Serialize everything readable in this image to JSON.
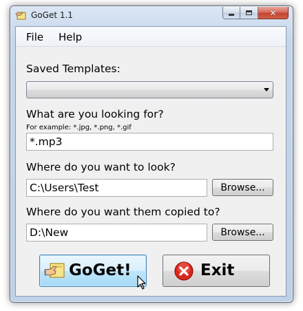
{
  "window": {
    "title": "GoGet 1.1",
    "close_glyph": "✕"
  },
  "menu": {
    "file": "File",
    "help": "Help"
  },
  "templates": {
    "label": "Saved Templates:",
    "selected": ""
  },
  "looking_for": {
    "label": "What are you looking for?",
    "hint": "For example: *.jpg, *.png, *.gif",
    "value": "*.mp3"
  },
  "look_in": {
    "label": "Where do you want to look?",
    "value": "C:\\Users\\Test",
    "browse_label": "Browse..."
  },
  "copy_to": {
    "label": "Where do you want them copied to?",
    "value": "D:\\New",
    "browse_label": "Browse..."
  },
  "actions": {
    "goget_label": "GoGet!",
    "exit_label": "Exit"
  },
  "icons": {
    "app": "app-hand-icon",
    "goget": "hand-folder-icon",
    "exit": "red-x-circle-icon",
    "cursor": "arrow-cursor-icon"
  },
  "colors": {
    "goget_hover": "#bee6fd",
    "exit_red": "#d9261c"
  }
}
